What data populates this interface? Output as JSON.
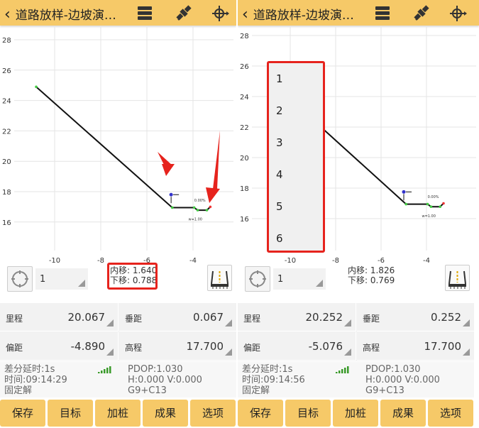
{
  "colors": {
    "accent": "#F6C968",
    "annotation": "#e6231d",
    "line": "#111111",
    "signal": "#3a9a2a"
  },
  "chart_data": {
    "type": "line",
    "x_ticks": [
      -10,
      -8,
      -6,
      -4
    ],
    "y_ticks": [
      16,
      18,
      20,
      22,
      24,
      26,
      28
    ],
    "xlim": [
      -11.8,
      -2.3
    ],
    "ylim": [
      14.3,
      28.7
    ],
    "grid": true,
    "section_line": [
      [
        -10.8,
        24.9
      ],
      [
        -4.9,
        16.95
      ],
      [
        -3.95,
        16.95
      ],
      [
        -3.8,
        16.78
      ],
      [
        -3.4,
        16.78
      ],
      [
        -3.25,
        17.0
      ]
    ],
    "slope_label": "0.00%",
    "width_label": "w=1.00"
  },
  "screens": [
    {
      "title": "道路放样-边坡演…",
      "icons": [
        "chevron-left-icon",
        "layers-icon",
        "satellite-icon",
        "target-crosshair-icon"
      ],
      "current_point": [
        -4.95,
        17.8
      ],
      "station_select": "1",
      "offsets": {
        "inner": "内移: 1.640",
        "down": "下移: 0.788"
      },
      "fields": [
        {
          "label": "里程",
          "value": "20.067"
        },
        {
          "label": "垂距",
          "value": "0.067"
        },
        {
          "label": "偏距",
          "value": "-4.890"
        },
        {
          "label": "高程",
          "value": "17.700"
        }
      ],
      "status": {
        "delay": "差分延时:1s",
        "time": "时间:09:14:29",
        "solution": "固定解",
        "pdop": "PDOP:1.030",
        "hv": "H:0.000  V:0.000",
        "sats": "G9+C13"
      },
      "buttons": [
        "保存",
        "目标",
        "加桩",
        "成果",
        "选项"
      ],
      "highlight_offsets": true,
      "arrows": true,
      "dropdown_open": false
    },
    {
      "title": "道路放样-边坡演…",
      "icons": [
        "chevron-left-icon",
        "layers-icon",
        "satellite-icon",
        "target-crosshair-icon"
      ],
      "current_point": [
        -5.0,
        17.75
      ],
      "station_select": "1",
      "offsets": {
        "inner": "内移: 1.826",
        "down": "下移: 0.769"
      },
      "fields": [
        {
          "label": "里程",
          "value": "20.252"
        },
        {
          "label": "垂距",
          "value": "0.252"
        },
        {
          "label": "偏距",
          "value": "-5.076"
        },
        {
          "label": "高程",
          "value": "17.700"
        }
      ],
      "status": {
        "delay": "差分延时:1s",
        "time": "时间:09:14:56",
        "solution": "固定解",
        "pdop": "PDOP:1.030",
        "hv": "H:0.000  V:0.000",
        "sats": "G9+C13"
      },
      "buttons": [
        "保存",
        "目标",
        "加桩",
        "成果",
        "选项"
      ],
      "highlight_offsets": false,
      "arrows": false,
      "dropdown_open": true,
      "dropdown_options": [
        "1",
        "2",
        "3",
        "4",
        "5",
        "6"
      ]
    }
  ]
}
